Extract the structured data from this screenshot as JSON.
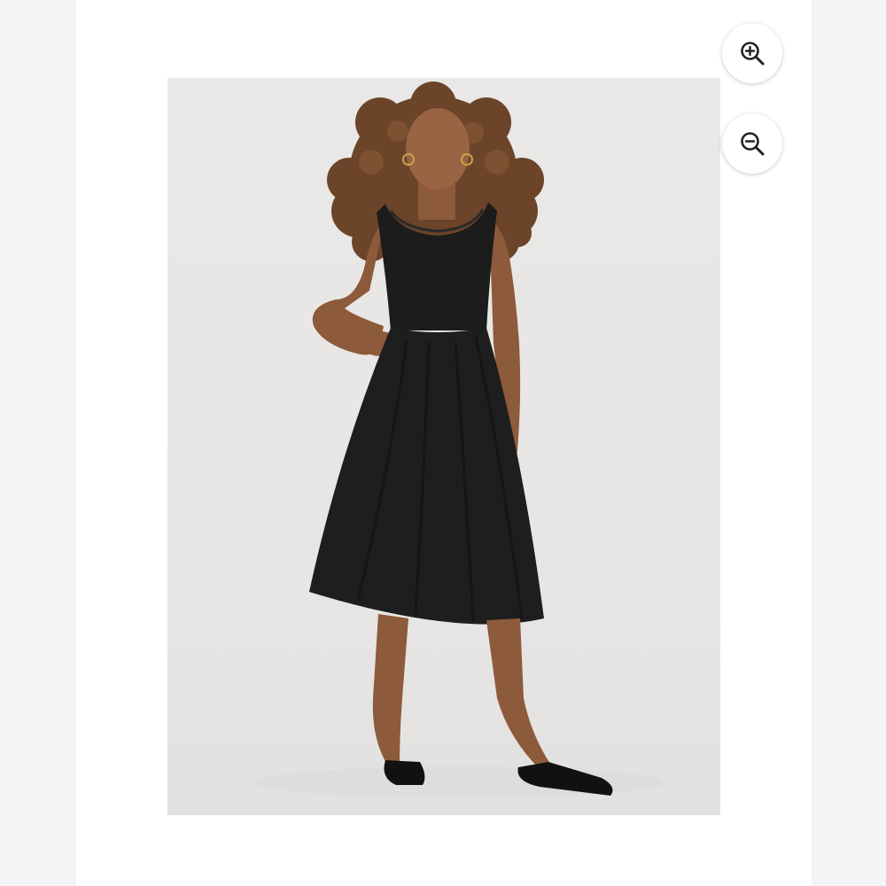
{
  "viewer": {
    "image": {
      "subject": "model-in-black-midi-dress",
      "background_color": "#e8e7e5",
      "dress_color": "#1b1b1b"
    },
    "controls": {
      "zoom_in_icon": "zoom-in-icon",
      "zoom_out_icon": "zoom-out-icon"
    }
  }
}
